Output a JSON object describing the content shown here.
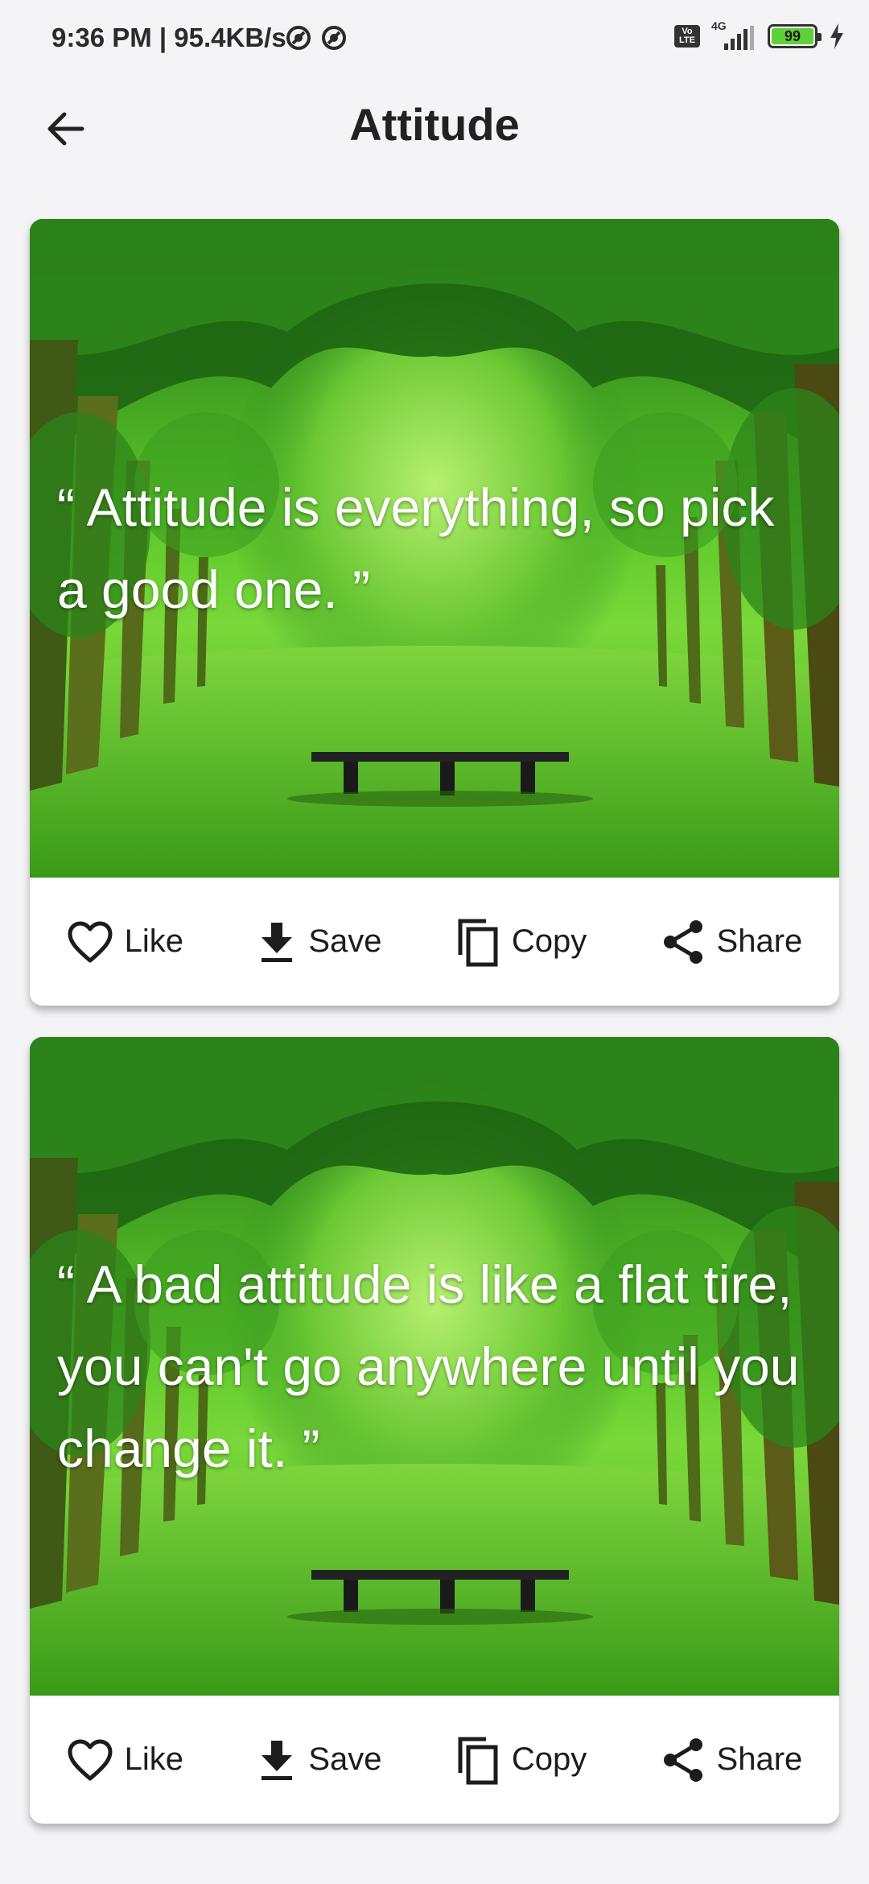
{
  "status_bar": {
    "time": "9:36 PM | 95.4KB/s",
    "network": "4G",
    "volte_top": "Vo",
    "volte_bottom": "LTE",
    "battery": "99"
  },
  "header": {
    "title": "Attitude",
    "back_icon": "arrow-left-icon"
  },
  "quotes": [
    {
      "text": "“ Attitude is everything, so pick a good one. ”",
      "actions": [
        {
          "label": "Like",
          "icon": "heart-outline-icon"
        },
        {
          "label": "Save",
          "icon": "download-icon"
        },
        {
          "label": "Copy",
          "icon": "copy-icon"
        },
        {
          "label": "Share",
          "icon": "share-icon"
        }
      ]
    },
    {
      "text": "“ A bad attitude is like a flat tire, you can't go anywhere until you change it. ”",
      "actions": [
        {
          "label": "Like",
          "icon": "heart-outline-icon"
        },
        {
          "label": "Save",
          "icon": "download-icon"
        },
        {
          "label": "Copy",
          "icon": "copy-icon"
        },
        {
          "label": "Share",
          "icon": "share-icon"
        }
      ]
    }
  ],
  "colors": {
    "background": "#f4f4f6",
    "battery_fill": "#5fd038",
    "foliage": "#2e8b1e",
    "grass": "#5ec21e"
  }
}
